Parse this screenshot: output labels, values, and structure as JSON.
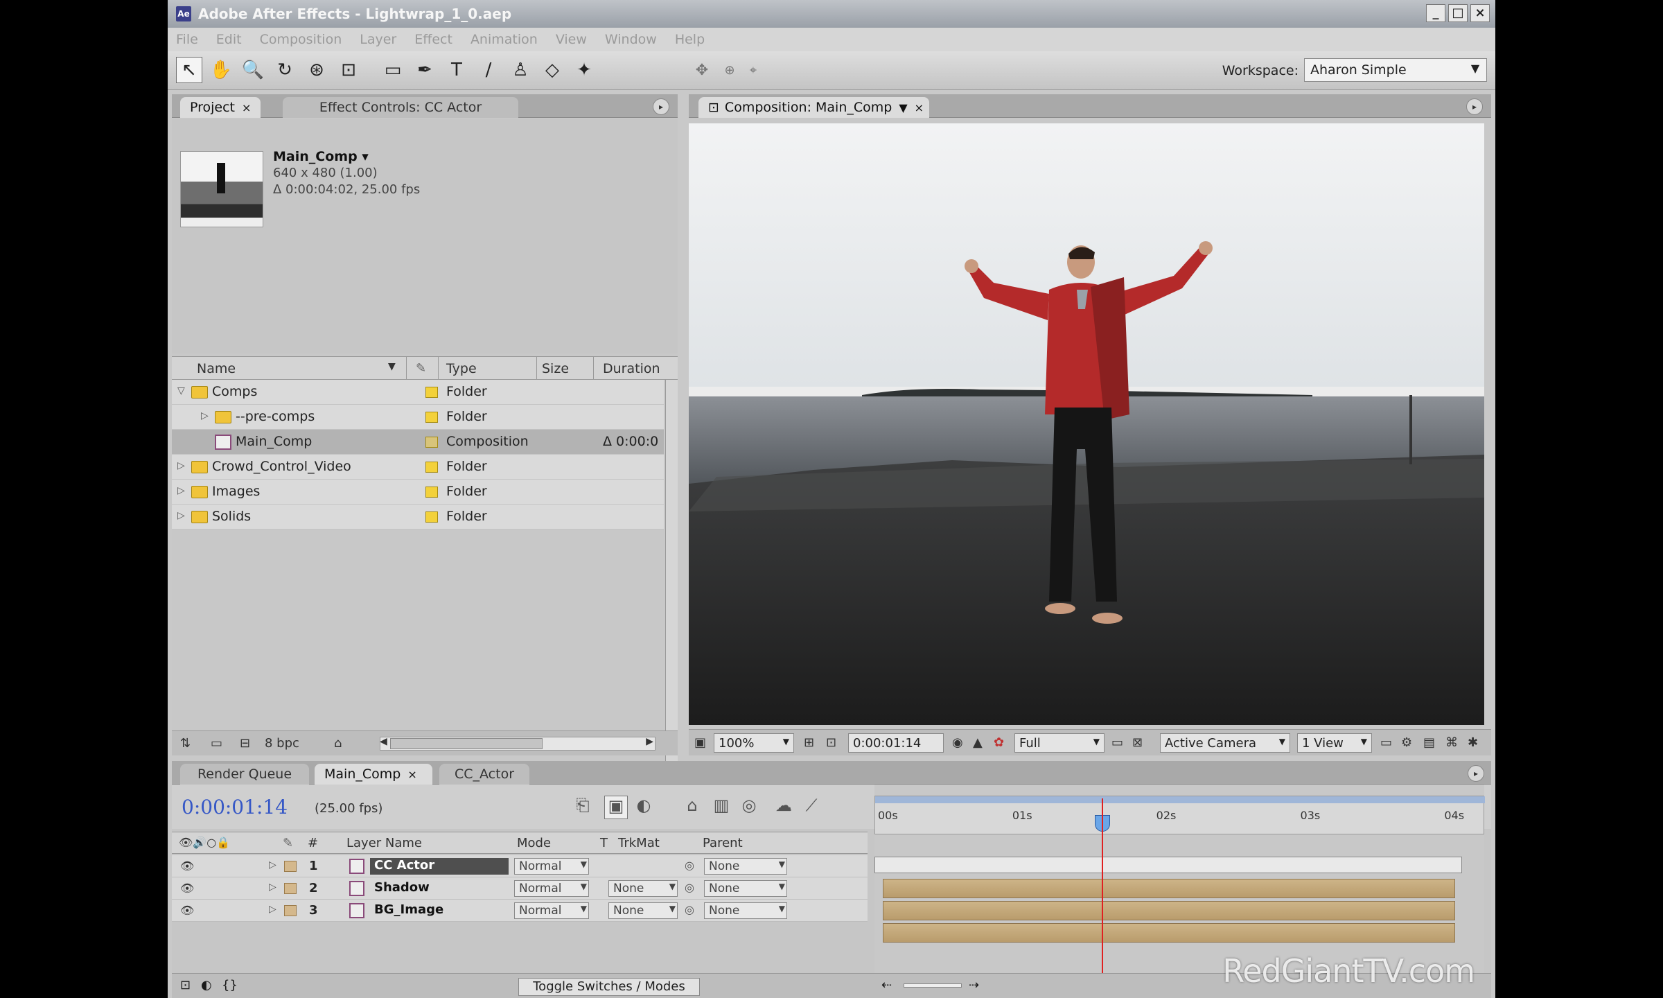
{
  "window": {
    "title": "Adobe After Effects - Lightwrap_1_0.aep",
    "app_icon": "Ae",
    "controls": [
      "_",
      "□",
      "×"
    ]
  },
  "menu": [
    "File",
    "Edit",
    "Composition",
    "Layer",
    "Effect",
    "Animation",
    "View",
    "Window",
    "Help"
  ],
  "toolbar": {
    "tools": [
      {
        "icon": "selection-tool-icon",
        "glyph": "↖",
        "active": true
      },
      {
        "icon": "hand-tool-icon",
        "glyph": "✋"
      },
      {
        "icon": "zoom-tool-icon",
        "glyph": "🔍"
      },
      {
        "icon": "rotate-tool-icon",
        "glyph": "↻"
      },
      {
        "icon": "orbit-camera-icon",
        "glyph": "⊛"
      },
      {
        "icon": "pan-behind-icon",
        "glyph": "⊡"
      },
      {
        "icon": "rectangle-mask-icon",
        "glyph": "▭"
      },
      {
        "icon": "pen-tool-icon",
        "glyph": "✒"
      },
      {
        "icon": "type-tool-icon",
        "glyph": "T"
      },
      {
        "icon": "brush-tool-icon",
        "glyph": "∕"
      },
      {
        "icon": "clone-stamp-icon",
        "glyph": "♙"
      },
      {
        "icon": "eraser-tool-icon",
        "glyph": "◇"
      },
      {
        "icon": "puppet-pin-icon",
        "glyph": "✦"
      }
    ],
    "workspace_label": "Workspace:",
    "workspace_value": "Aharon Simple"
  },
  "project_panel": {
    "tabs": [
      {
        "label": "Project",
        "closable": true,
        "active": true
      },
      {
        "label": "Effect Controls: CC Actor",
        "closable": false,
        "active": false
      }
    ],
    "selected_item": {
      "name": "Main_Comp ▾",
      "dimensions": "640 x 480 (1.00)",
      "duration": "Δ 0:00:04:02, 25.00 fps"
    },
    "columns": {
      "name": "Name",
      "type": "Type",
      "size": "Size",
      "duration": "Duration"
    },
    "items": [
      {
        "name": "Comps",
        "type": "Folder",
        "kind": "folder",
        "indent": 0,
        "expanded": true,
        "duration": ""
      },
      {
        "name": "--pre-comps",
        "type": "Folder",
        "kind": "folder",
        "indent": 1,
        "expanded": false,
        "duration": ""
      },
      {
        "name": "Main_Comp",
        "type": "Composition",
        "kind": "comp",
        "indent": 1,
        "selected": true,
        "duration": "Δ 0:00:0"
      },
      {
        "name": "Crowd_Control_Video",
        "type": "Folder",
        "kind": "folder",
        "indent": 0,
        "duration": ""
      },
      {
        "name": "Images",
        "type": "Folder",
        "kind": "folder",
        "indent": 0,
        "duration": ""
      },
      {
        "name": "Solids",
        "type": "Folder",
        "kind": "folder",
        "indent": 0,
        "duration": ""
      }
    ],
    "footer": {
      "bpc": "8 bpc"
    }
  },
  "comp_panel": {
    "tab_label": "Composition: Main_Comp",
    "footer": {
      "zoom": "100%",
      "timecode": "0:00:01:14",
      "resolution": "Full",
      "camera": "Active Camera",
      "views": "1 View"
    }
  },
  "timeline": {
    "tabs": [
      {
        "label": "Render Queue",
        "active": false
      },
      {
        "label": "Main_Comp",
        "active": true,
        "closable": true
      },
      {
        "label": "CC_Actor",
        "active": false
      }
    ],
    "timecode": "0:00:01:14",
    "fps": "(25.00 fps)",
    "columns": {
      "num": "#",
      "layer_name": "Layer Name",
      "mode": "Mode",
      "t": "T",
      "trkmat": "TrkMat",
      "parent": "Parent"
    },
    "layers": [
      {
        "num": "1",
        "name": "CC Actor",
        "mode": "Normal",
        "trkmat": "",
        "parent": "None",
        "selected": true
      },
      {
        "num": "2",
        "name": "Shadow",
        "mode": "Normal",
        "trkmat": "None",
        "parent": "None"
      },
      {
        "num": "3",
        "name": "BG_Image",
        "mode": "Normal",
        "trkmat": "None",
        "parent": "None"
      }
    ],
    "ruler_ticks": [
      "00s",
      "01s",
      "02s",
      "03s",
      "04s"
    ],
    "current_time_seconds": 1.56,
    "duration_seconds": 4.08,
    "toggle_label": "Toggle Switches / Modes"
  },
  "watermark": "RedGiantTV.com"
}
